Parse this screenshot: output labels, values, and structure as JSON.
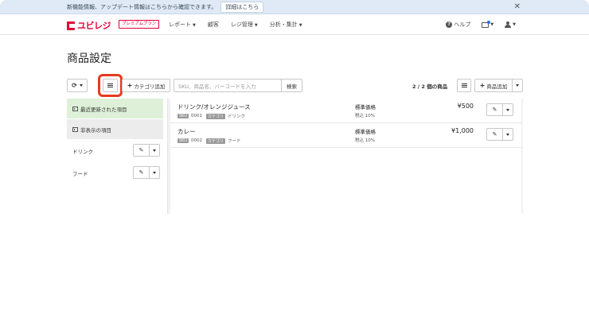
{
  "notice": {
    "text": "新機能情報、アップデート情報はこちらから確認できます。",
    "detail_button": "詳細はこちら",
    "close_icon": "close-icon"
  },
  "header": {
    "logo_text": "ユビレジ",
    "plan_badge": "プレミアムプラン",
    "nav": [
      {
        "label": "レポート",
        "has_caret": true
      },
      {
        "label": "顧客",
        "has_caret": false
      },
      {
        "label": "レジ管理",
        "has_caret": true
      },
      {
        "label": "分析・集計",
        "has_caret": true
      }
    ],
    "help_label": "ヘルプ"
  },
  "page": {
    "title": "商品設定"
  },
  "toolbar": {
    "add_category_label": "カテゴリ追加",
    "search_placeholder": "SKU、商品名、バーコードを入力",
    "search_button": "検索",
    "count_text": "2 / 2 個の商品",
    "add_item_label": "商品追加"
  },
  "sidebar": {
    "items": [
      {
        "label": "最近更新された項目",
        "state": "active"
      },
      {
        "label": "非表示の項目",
        "state": "muted"
      }
    ],
    "categories": [
      {
        "label": "ドリンク"
      },
      {
        "label": "フード"
      }
    ]
  },
  "products": [
    {
      "name": "ドリンク/オレンジジュース",
      "sku_tag": "SKU",
      "sku": "0001",
      "category_tag": "カテゴリ",
      "category": "ドリンク",
      "price_label": "標準価格",
      "tax": "税込 10%",
      "price": "¥500"
    },
    {
      "name": "カレー",
      "sku_tag": "SKU",
      "sku": "0002",
      "category_tag": "カテゴリ",
      "category": "フード",
      "price_label": "標準価格",
      "tax": "税込 10%",
      "price": "¥1,000"
    }
  ],
  "colors": {
    "brand": "#e60039",
    "highlight": "#e8391e",
    "active_bg": "#def1d8",
    "notice_bg": "#dfeaf6"
  }
}
